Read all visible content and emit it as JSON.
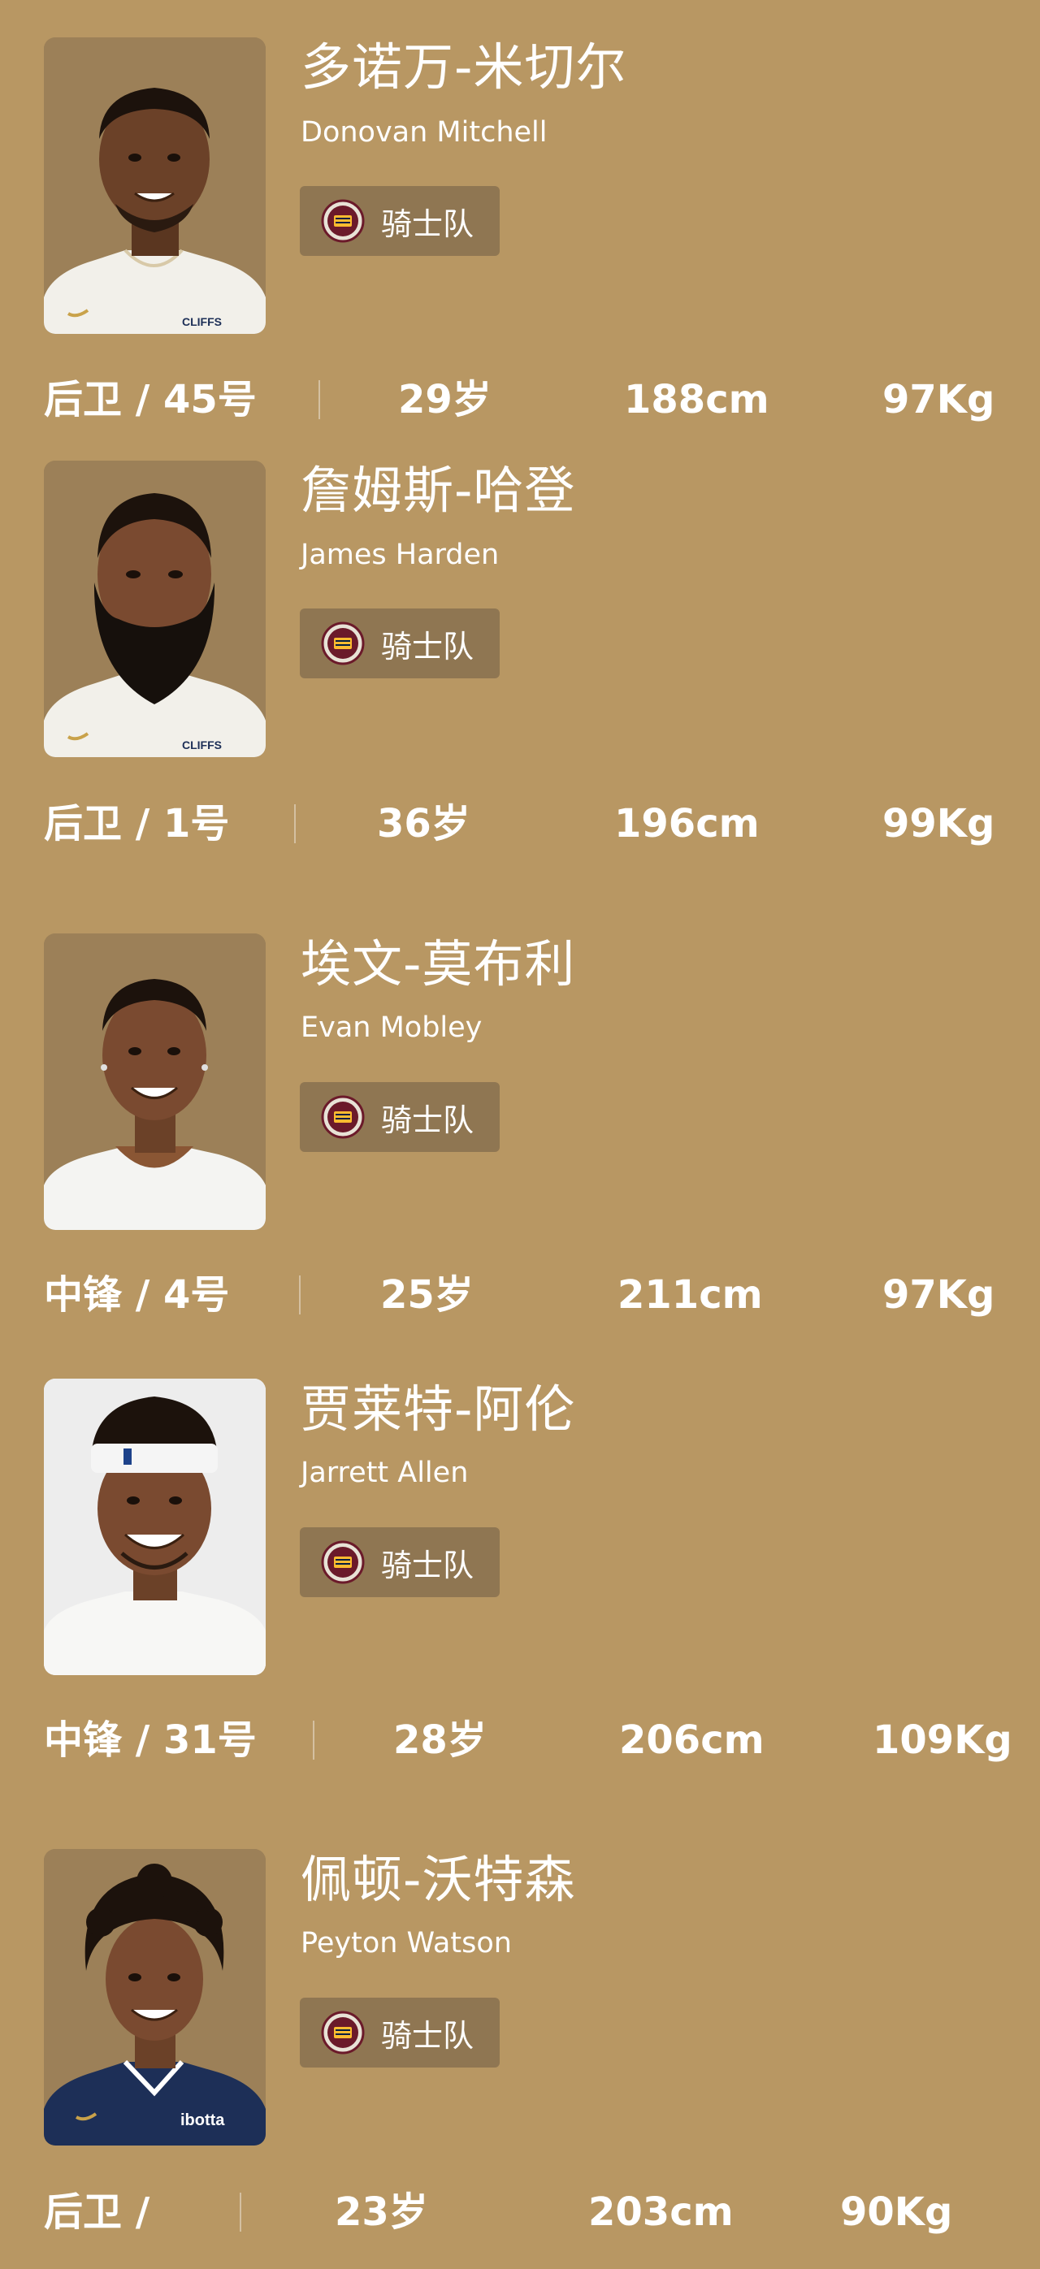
{
  "team": {
    "label": "骑士队"
  },
  "players": [
    {
      "name_cn": "多诺万-米切尔",
      "name_en": "Donovan Mitchell",
      "position_number": "后卫 / 45号",
      "age": "29岁",
      "height": "188cm",
      "weight": "97Kg",
      "jersey_text": "CLIFFS"
    },
    {
      "name_cn": "詹姆斯-哈登",
      "name_en": "James Harden",
      "position_number": "后卫 / 1号",
      "age": "36岁",
      "height": "196cm",
      "weight": "99Kg",
      "jersey_text": "CLIFFS"
    },
    {
      "name_cn": "埃文-莫布利",
      "name_en": "Evan Mobley",
      "position_number": "中锋 / 4号",
      "age": "25岁",
      "height": "211cm",
      "weight": "97Kg"
    },
    {
      "name_cn": "贾莱特-阿伦",
      "name_en": "Jarrett Allen",
      "position_number": "中锋 / 31号",
      "age": "28岁",
      "height": "206cm",
      "weight": "109Kg"
    },
    {
      "name_cn": "佩顿-沃特森",
      "name_en": "Peyton Watson",
      "position_number": "后卫 /",
      "age": "23岁",
      "height": "203cm",
      "weight": "90Kg",
      "jersey_text": "ibotta"
    }
  ],
  "colors": {
    "background": "#b89763",
    "photo_bg": "#9c8058",
    "badge_bg": "#8f7652",
    "text": "#ffffff"
  }
}
